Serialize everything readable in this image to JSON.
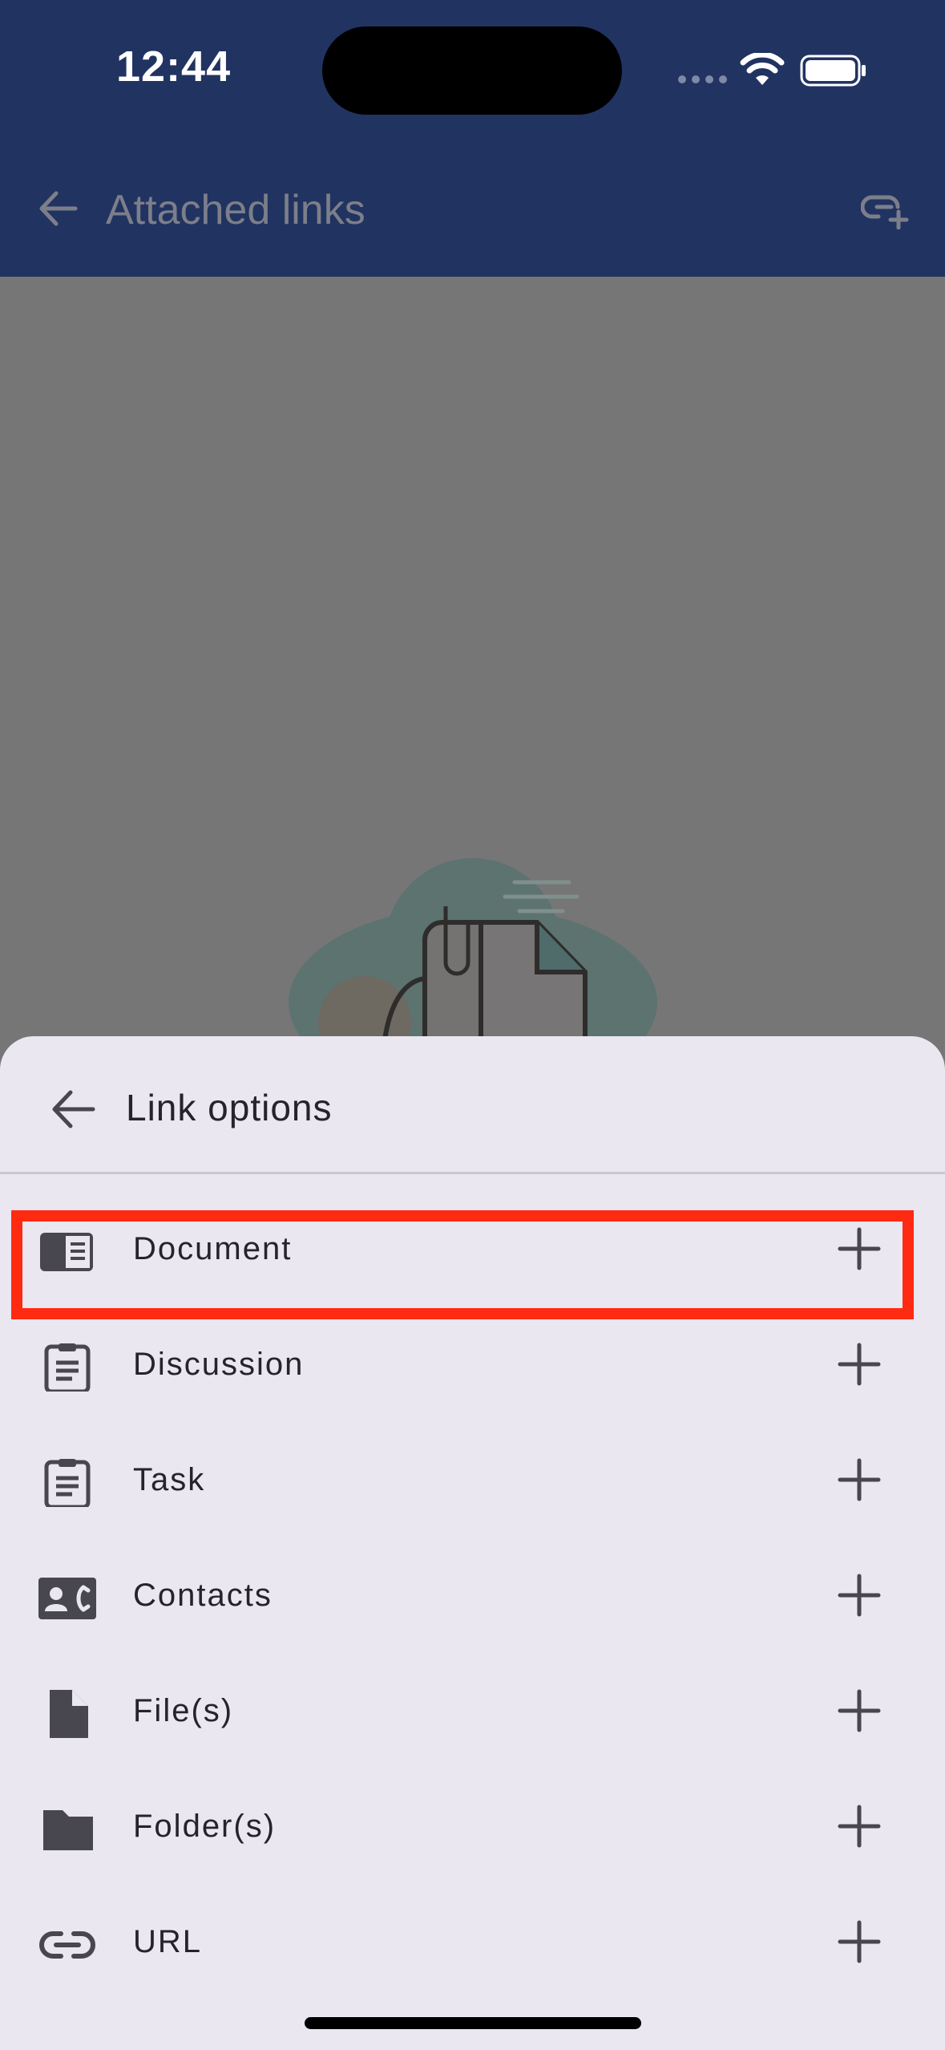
{
  "status_bar": {
    "time": "12:44"
  },
  "app_bar": {
    "title": "Attached links"
  },
  "sheet": {
    "title": "Link options",
    "options": [
      {
        "label": "Document",
        "icon": "document-icon"
      },
      {
        "label": "Discussion",
        "icon": "clipboard-icon"
      },
      {
        "label": "Task",
        "icon": "clipboard-icon"
      },
      {
        "label": "Contacts",
        "icon": "contact-card-icon"
      },
      {
        "label": "File(s)",
        "icon": "file-icon"
      },
      {
        "label": "Folder(s)",
        "icon": "folder-icon"
      },
      {
        "label": "URL",
        "icon": "link-icon"
      }
    ],
    "highlighted_option": "Document"
  },
  "colors": {
    "header": "#213361",
    "scrim": "#767676",
    "sheet": "#eae7f1",
    "highlight": "#ff2a12",
    "icon": "#48464f"
  }
}
